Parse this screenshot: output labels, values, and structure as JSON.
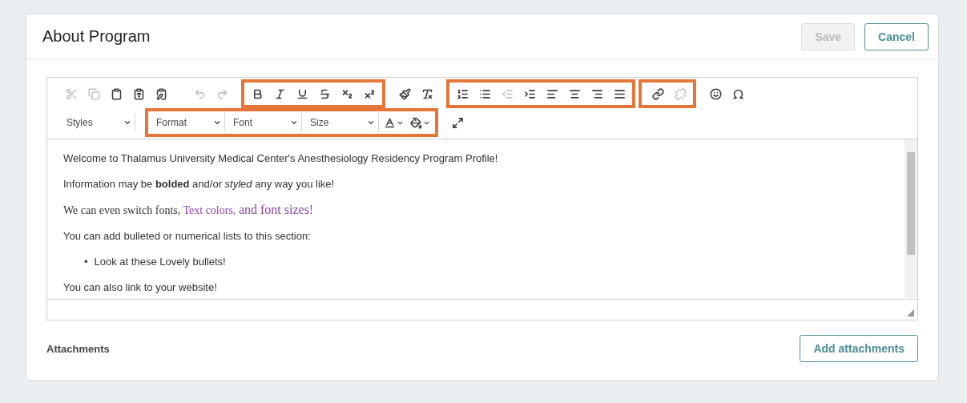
{
  "header": {
    "title": "About Program",
    "buttons": [
      {
        "label": "Save",
        "kind": "primary",
        "disabled": true
      },
      {
        "label": "Cancel",
        "kind": "outline",
        "disabled": false
      }
    ]
  },
  "toolbar": {
    "rows": [
      [
        {
          "highlighted": false,
          "items": [
            {
              "kind": "cut",
              "disabled": true
            },
            {
              "kind": "copy",
              "disabled": true
            },
            {
              "kind": "paste",
              "disabled": false
            },
            {
              "kind": "paste-text",
              "disabled": false
            },
            {
              "kind": "paste-word",
              "disabled": false
            }
          ]
        },
        {
          "highlighted": false,
          "items": [
            {
              "kind": "undo",
              "disabled": true
            },
            {
              "kind": "redo",
              "disabled": true
            }
          ]
        },
        {
          "highlighted": true,
          "items": [
            {
              "kind": "bold",
              "disabled": false
            },
            {
              "kind": "italic",
              "disabled": false
            },
            {
              "kind": "underline",
              "disabled": false
            },
            {
              "kind": "strike",
              "disabled": false
            },
            {
              "kind": "subscript",
              "disabled": false
            },
            {
              "kind": "superscript",
              "disabled": false
            }
          ]
        },
        {
          "highlighted": false,
          "items": [
            {
              "kind": "brush",
              "disabled": false
            },
            {
              "kind": "clear-format",
              "disabled": false
            }
          ]
        },
        {
          "highlighted": true,
          "items": [
            {
              "kind": "numbered-list",
              "disabled": false
            },
            {
              "kind": "bulleted-list",
              "disabled": false
            },
            {
              "kind": "outdent",
              "disabled": true
            },
            {
              "kind": "indent",
              "disabled": false
            },
            {
              "kind": "align-left",
              "disabled": false
            },
            {
              "kind": "align-center",
              "disabled": false
            },
            {
              "kind": "align-right",
              "disabled": false
            },
            {
              "kind": "justify",
              "disabled": false
            }
          ]
        },
        {
          "highlighted": true,
          "items": [
            {
              "kind": "link",
              "disabled": false
            },
            {
              "kind": "unlink",
              "disabled": true
            }
          ]
        },
        {
          "highlighted": false,
          "items": [
            {
              "kind": "smiley",
              "disabled": false
            },
            {
              "kind": "omega",
              "disabled": false
            }
          ]
        }
      ],
      [
        {
          "highlighted": false,
          "items": [
            {
              "kind": "dropdown",
              "label": "Styles"
            }
          ]
        },
        {
          "highlighted": true,
          "items": [
            {
              "kind": "dropdown",
              "label": "Format"
            },
            {
              "kind": "dropdown",
              "label": "Font"
            },
            {
              "kind": "dropdown",
              "label": "Size"
            },
            {
              "kind": "text-color",
              "disabled": false
            },
            {
              "kind": "background-color",
              "disabled": false
            }
          ]
        },
        {
          "highlighted": false,
          "items": [
            {
              "kind": "maximize",
              "disabled": false
            }
          ]
        }
      ]
    ]
  },
  "content": {
    "paragraphs": [
      {
        "kind": "text",
        "text": "Welcome to Thalamus University Medical Center's Anesthesiology Residency Program Profile!"
      },
      {
        "kind": "text",
        "text": "Information may be **bolded** and/or *styled* any way you like!"
      },
      {
        "kind": "segments",
        "segments": [
          "We can even switch fonts, ",
          "Text colors, ",
          "and font sizes!"
        ]
      },
      {
        "kind": "text",
        "text": "You can add bulleted or numerical lists to this section:"
      },
      {
        "kind": "bullets",
        "items": [
          {
            "marker": "•",
            "text": "Look at these Lovely bullets!"
          }
        ]
      },
      {
        "kind": "text",
        "text": "You can also link to your website!"
      }
    ]
  },
  "attachments": {
    "label": "Attachments",
    "button": "Add attachments"
  }
}
